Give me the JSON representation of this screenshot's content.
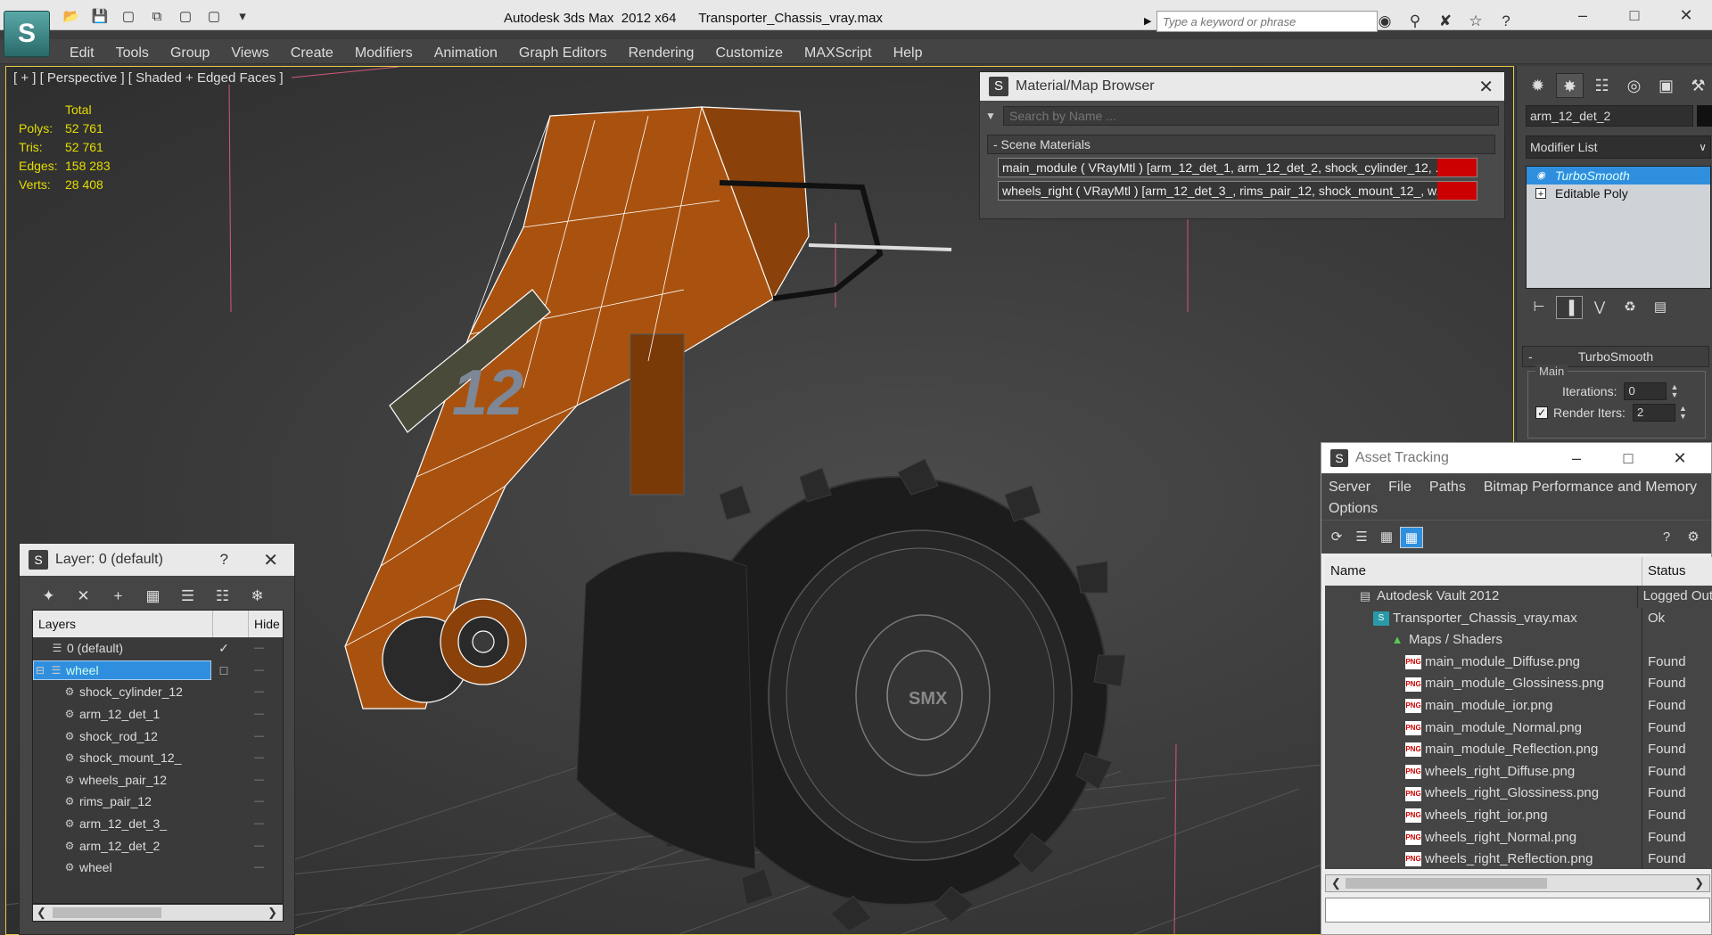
{
  "app": {
    "logo_text": "S",
    "title": "Autodesk 3ds Max  2012 x64      Transporter_Chassis_vray.max",
    "search_placeholder": "Type a keyword or phrase",
    "quick_access": [
      "folder-open-icon",
      "save-icon",
      "new-icon",
      "copy-icon",
      "window-icon",
      "window-icon",
      "dropdown-icon"
    ],
    "window_controls": [
      "–",
      "□",
      "✕"
    ]
  },
  "menu": [
    "Edit",
    "Tools",
    "Group",
    "Views",
    "Create",
    "Modifiers",
    "Animation",
    "Graph Editors",
    "Rendering",
    "Customize",
    "MAXScript",
    "Help"
  ],
  "viewport": {
    "label": "[ + ] [ Perspective ] [ Shaded + Edged Faces ]",
    "stats": {
      "header": "Total",
      "rows": [
        {
          "key": "Polys:",
          "value": "52 761"
        },
        {
          "key": "Tris:",
          "value": "52 761"
        },
        {
          "key": "Edges:",
          "value": "158 283"
        },
        {
          "key": "Verts:",
          "value": "28 408"
        }
      ]
    },
    "wheel_logo": "SMX",
    "arm_number": "12"
  },
  "material_browser": {
    "title": "Material/Map Browser",
    "search_placeholder": "Search by Name ...",
    "group": "- Scene Materials",
    "rows": [
      "main_module  ( VRayMtl )  [arm_12_det_1, arm_12_det_2, shock_cylinder_12, ...",
      "wheels_right  ( VRayMtl )  [arm_12_det_3_, rims_pair_12, shock_mount_12_, w..."
    ]
  },
  "command_panel": {
    "object_name": "arm_12_det_2",
    "modifier_list": "Modifier List",
    "stack": [
      {
        "label": "TurboSmooth",
        "selected": true
      },
      {
        "label": "Editable Poly",
        "selected": false
      }
    ],
    "rollout": "TurboSmooth",
    "group": "Main",
    "iterations_label": "Iterations:",
    "iterations_value": "0",
    "render_iters_label": "Render Iters:",
    "render_iters_value": "2"
  },
  "layers": {
    "title": "Layer: 0 (default)",
    "help": "?",
    "col_layers": "Layers",
    "col_hide": "Hide",
    "rows": [
      {
        "label": "0 (default)",
        "indent": 1,
        "check": true
      },
      {
        "label": "wheel",
        "indent": 0,
        "selected": true
      },
      {
        "label": "shock_cylinder_12",
        "indent": 2
      },
      {
        "label": "arm_12_det_1",
        "indent": 2
      },
      {
        "label": "shock_rod_12",
        "indent": 2
      },
      {
        "label": "shock_mount_12_",
        "indent": 2
      },
      {
        "label": "wheels_pair_12",
        "indent": 2
      },
      {
        "label": "rims_pair_12",
        "indent": 2
      },
      {
        "label": "arm_12_det_3_",
        "indent": 2
      },
      {
        "label": "arm_12_det_2",
        "indent": 2
      },
      {
        "label": "wheel",
        "indent": 2
      }
    ]
  },
  "asset_tracking": {
    "title": "Asset Tracking",
    "menu_line1": [
      "Server",
      "File",
      "Paths",
      "Bitmap Performance and Memory"
    ],
    "menu_line2": [
      "Options"
    ],
    "col_name": "Name",
    "col_status": "Status",
    "rows": [
      {
        "name": "Autodesk Vault 2012",
        "status": "Logged Out",
        "icon": "vault",
        "indent": 1
      },
      {
        "name": "Transporter_Chassis_vray.max",
        "status": "Ok",
        "icon": "max",
        "indent": 2
      },
      {
        "name": "Maps / Shaders",
        "status": "",
        "icon": "maps",
        "indent": 3
      },
      {
        "name": "main_module_Diffuse.png",
        "status": "Found",
        "icon": "png",
        "indent": 4
      },
      {
        "name": "main_module_Glossiness.png",
        "status": "Found",
        "icon": "png",
        "indent": 4
      },
      {
        "name": "main_module_ior.png",
        "status": "Found",
        "icon": "png",
        "indent": 4
      },
      {
        "name": "main_module_Normal.png",
        "status": "Found",
        "icon": "png",
        "indent": 4
      },
      {
        "name": "main_module_Reflection.png",
        "status": "Found",
        "icon": "png",
        "indent": 4
      },
      {
        "name": "wheels_right_Diffuse.png",
        "status": "Found",
        "icon": "png",
        "indent": 4
      },
      {
        "name": "wheels_right_Glossiness.png",
        "status": "Found",
        "icon": "png",
        "indent": 4
      },
      {
        "name": "wheels_right_ior.png",
        "status": "Found",
        "icon": "png",
        "indent": 4
      },
      {
        "name": "wheels_right_Normal.png",
        "status": "Found",
        "icon": "png",
        "indent": 4
      },
      {
        "name": "wheels_right_Reflection.png",
        "status": "Found",
        "icon": "png",
        "indent": 4
      }
    ]
  },
  "colors": {
    "selection_blue": "#2f8fde",
    "stats_yellow": "#e6dd00",
    "arm_orange": "#b85a10",
    "viewport_border": "#e6c84a"
  }
}
